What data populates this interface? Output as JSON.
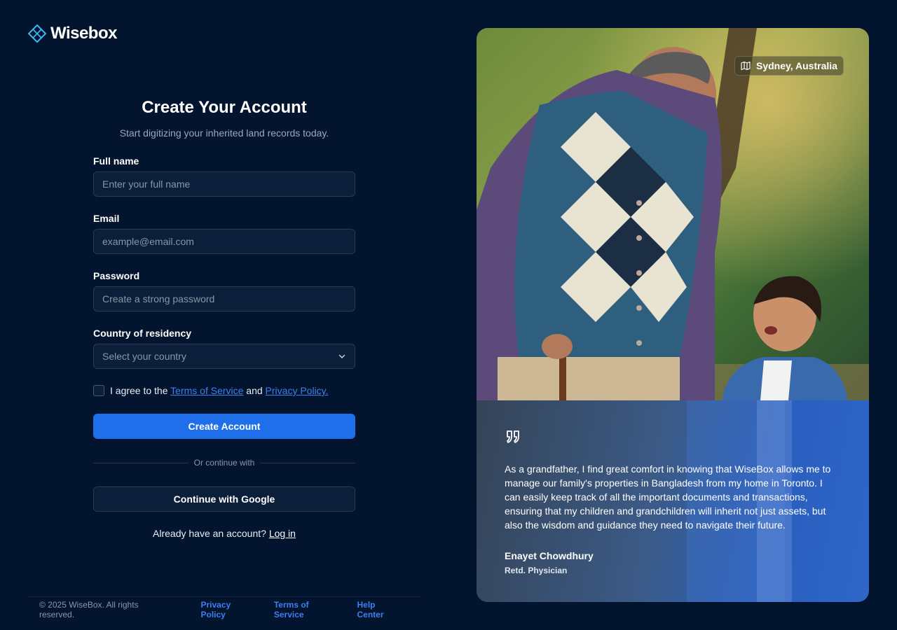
{
  "brand": {
    "name": "Wisebox",
    "accent": "#1f6fea",
    "logo_color": "#38b8f2"
  },
  "form": {
    "title": "Create Your Account",
    "subtitle": "Start digitizing your inherited land records today.",
    "full_name": {
      "label": "Full name",
      "placeholder": "Enter your full name",
      "value": ""
    },
    "email": {
      "label": "Email",
      "placeholder": "example@email.com",
      "value": ""
    },
    "password": {
      "label": "Password",
      "placeholder": "Create a strong password",
      "value": ""
    },
    "country": {
      "label": "Country of residency",
      "placeholder": "Select your country"
    },
    "agree": {
      "prefix": "I agree to the",
      "terms": "Terms of Service",
      "middle": "and",
      "privacy": "Privacy Policy.",
      "checked": false
    },
    "submit_label": "Create Account",
    "divider_text": "Or continue with",
    "google_label": "Continue with Google",
    "login_prompt": "Already have an account?",
    "login_link": "Log in"
  },
  "footer": {
    "copyright": "© 2025 WiseBox. All rights reserved.",
    "links": [
      "Privacy Policy",
      "Terms of Service",
      "Help Center"
    ]
  },
  "testimonial": {
    "location": "Sydney, Australia",
    "quote": "As a grandfather, I find great comfort in knowing that WiseBox allows me to manage our family's properties in Bangladesh from my home in Toronto. I can easily keep track of all the important documents and transactions, ensuring that my children and grandchildren will inherit not just assets, but also the wisdom and guidance they need to navigate their future.",
    "author": "Enayet Chowdhury",
    "role": "Retd. Physician",
    "icons": {
      "location": "map-icon",
      "quote": "quote-icon"
    }
  }
}
